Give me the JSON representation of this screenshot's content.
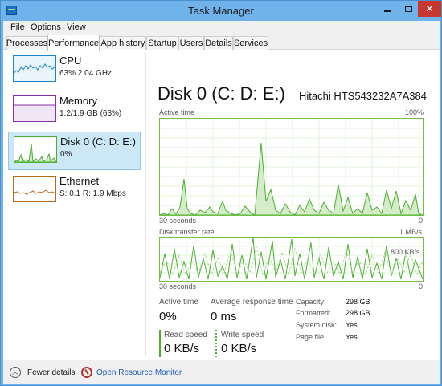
{
  "window": {
    "title": "Task Manager",
    "minimize": "—",
    "maximize": "☐",
    "close": "✕"
  },
  "menu": [
    "File",
    "Options",
    "View"
  ],
  "tabs": [
    "Processes",
    "Performance",
    "App history",
    "Startup",
    "Users",
    "Details",
    "Services"
  ],
  "active_tab": "Performance",
  "sidebar": {
    "items": [
      {
        "title": "CPU",
        "sub": "63% 2.04 GHz",
        "color": "#1b84c9"
      },
      {
        "title": "Memory",
        "sub": "1.2/1.9 GB (63%)",
        "color": "#8b2fb0"
      },
      {
        "title": "Disk 0 (C: D: E:)",
        "sub": "0%",
        "color": "#4caf32"
      },
      {
        "title": "Ethernet",
        "sub": "S: 0.1  R: 1.9 Mbps",
        "color": "#b86a1a"
      }
    ],
    "selected_index": 2
  },
  "detail": {
    "heading": "Disk 0 (C: D: E:)",
    "model": "Hitachi HTS543232A7A384",
    "active_graph": {
      "label": "Active time",
      "max": "100%",
      "left_axis": "30 seconds",
      "right_axis": "0"
    },
    "transfer_graph": {
      "label": "Disk transfer rate",
      "max": "1 MB/s",
      "mid": "800 KB/s",
      "left_axis": "30 seconds",
      "right_axis": "0"
    },
    "stats": {
      "active_time_label": "Active time",
      "active_time_value": "0%",
      "avg_response_label": "Average response time",
      "avg_response_value": "0 ms",
      "read_label": "Read speed",
      "read_value": "0 KB/s",
      "write_label": "Write speed",
      "write_value": "0 KB/s"
    },
    "info": [
      {
        "label": "Capacity:",
        "value": "298 GB"
      },
      {
        "label": "Formatted:",
        "value": "298 GB"
      },
      {
        "label": "System disk:",
        "value": "Yes"
      },
      {
        "label": "Page file:",
        "value": "Yes"
      }
    ]
  },
  "footer": {
    "fewer_details": "Fewer details",
    "open_monitor": "Open Resource Monitor"
  },
  "colors": {
    "disk_green": "#4caf32",
    "selection": "#cce8f7",
    "titlebar": "#6fb3ea",
    "link": "#1a5bb5"
  }
}
